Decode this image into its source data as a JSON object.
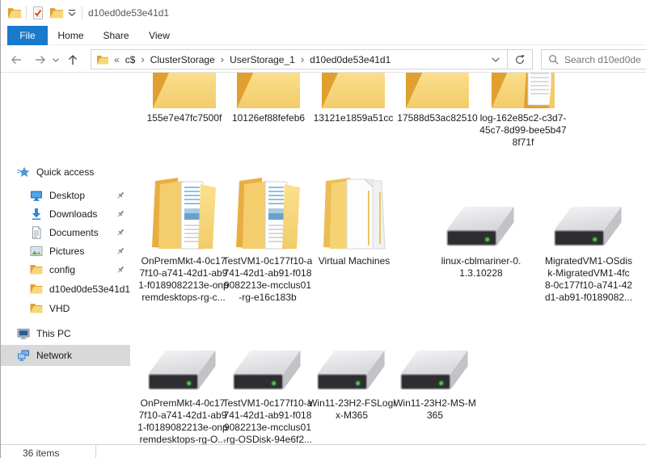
{
  "titlebar": {
    "title": "d10ed0de53e41d1",
    "app_icon": "folder-icon",
    "quick_access_toolbar": [
      "check-document-icon",
      "folder-icon",
      "customize-dropdown-icon"
    ]
  },
  "ribbon": {
    "tabs": [
      "File",
      "Home",
      "Share",
      "View"
    ],
    "active_tab": "File"
  },
  "toolbar": {
    "back_icon": "arrow-left-icon",
    "forward_icon": "arrow-right-icon",
    "recent_locations_icon": "chevron-down-icon",
    "up_icon": "arrow-up-icon",
    "address": {
      "icon": "folder-icon",
      "overflow": "«",
      "separator": "›",
      "crumbs": [
        "c$",
        "ClusterStorage",
        "UserStorage_1",
        "d10ed0de53e41d1"
      ],
      "dropdown_icon": "chevron-down-icon",
      "refresh_icon": "refresh-icon"
    },
    "search": {
      "icon": "magnifier-icon",
      "placeholder": "Search d10ed0de"
    }
  },
  "sidebar": {
    "quick_access": {
      "label": "Quick access",
      "icon": "star-icon",
      "items": [
        {
          "label": "Desktop",
          "icon": "desktop-icon",
          "pinned": true
        },
        {
          "label": "Downloads",
          "icon": "downloads-icon",
          "pinned": true
        },
        {
          "label": "Documents",
          "icon": "document-icon",
          "pinned": true
        },
        {
          "label": "Pictures",
          "icon": "pictures-icon",
          "pinned": true
        },
        {
          "label": "config",
          "icon": "folder-icon",
          "pinned": true
        },
        {
          "label": "d10ed0de53e41d1",
          "icon": "folder-icon",
          "pinned": false
        },
        {
          "label": "VHD",
          "icon": "folder-icon",
          "pinned": false
        }
      ]
    },
    "this_pc": {
      "label": "This PC",
      "icon": "computer-icon"
    },
    "network": {
      "label": "Network",
      "icon": "network-icon",
      "selected": true
    }
  },
  "files": {
    "rows": [
      [
        {
          "label": "155e7e47fc7500f",
          "icon": "folder-icon"
        },
        {
          "label": "10126ef88fefeb6",
          "icon": "folder-icon"
        },
        {
          "label": "13121e1859a51cc",
          "icon": "folder-icon"
        },
        {
          "label": "17588d53ac82510",
          "icon": "folder-icon"
        },
        {
          "label": "log-162e85c2-c3d7-\n45c7-8d99-bee5b47\n8f71f",
          "icon": "folder-with-document-icon"
        }
      ],
      [
        {
          "label": "OnPremMkt-4-0c17\n7f10-a741-42d1-ab9\n1-f0189082213e-onp\nremdesktops-rg-c...",
          "icon": "full-folder-icon"
        },
        {
          "label": "TestVM1-0c177f10-a\n741-42d1-ab91-f018\n9082213e-mcclus01\n-rg-e16c183b",
          "icon": "full-folder-icon"
        },
        {
          "label": "Virtual Machines",
          "icon": "folder-with-pages-icon"
        },
        {
          "label": "linux-cblmariner-0.\n1.3.10228",
          "icon": "hard-drive-icon"
        },
        {
          "label": "MigratedVM1-OSdis\nk-MigratedVM1-4fc\n8-0c177f10-a741-42\nd1-ab91-f0189082...",
          "icon": "hard-drive-icon"
        }
      ],
      [
        {
          "label": "OnPremMkt-4-0c17\n7f10-a741-42d1-ab9\n1-f0189082213e-onp\nremdesktops-rg-O...",
          "icon": "hard-drive-icon"
        },
        {
          "label": "TestVM1-0c177f10-a\n741-42d1-ab91-f018\n9082213e-mcclus01\n-rg-OSDisk-94e6f2...",
          "icon": "hard-drive-icon"
        },
        {
          "label": "Win11-23H2-FSLogi\nx-M365",
          "icon": "hard-drive-icon"
        },
        {
          "label": "Win11-23H2-MS-M\n365",
          "icon": "hard-drive-icon"
        }
      ]
    ]
  },
  "statusbar": {
    "count": "36 items"
  },
  "colors": {
    "active_tab_blue": "#1979ca",
    "folder_front": "#f7d77a",
    "folder_back": "#dfa02f",
    "disk_led_green": "#3fc94a",
    "selected_sidebar_row": "#d9d9d9"
  }
}
